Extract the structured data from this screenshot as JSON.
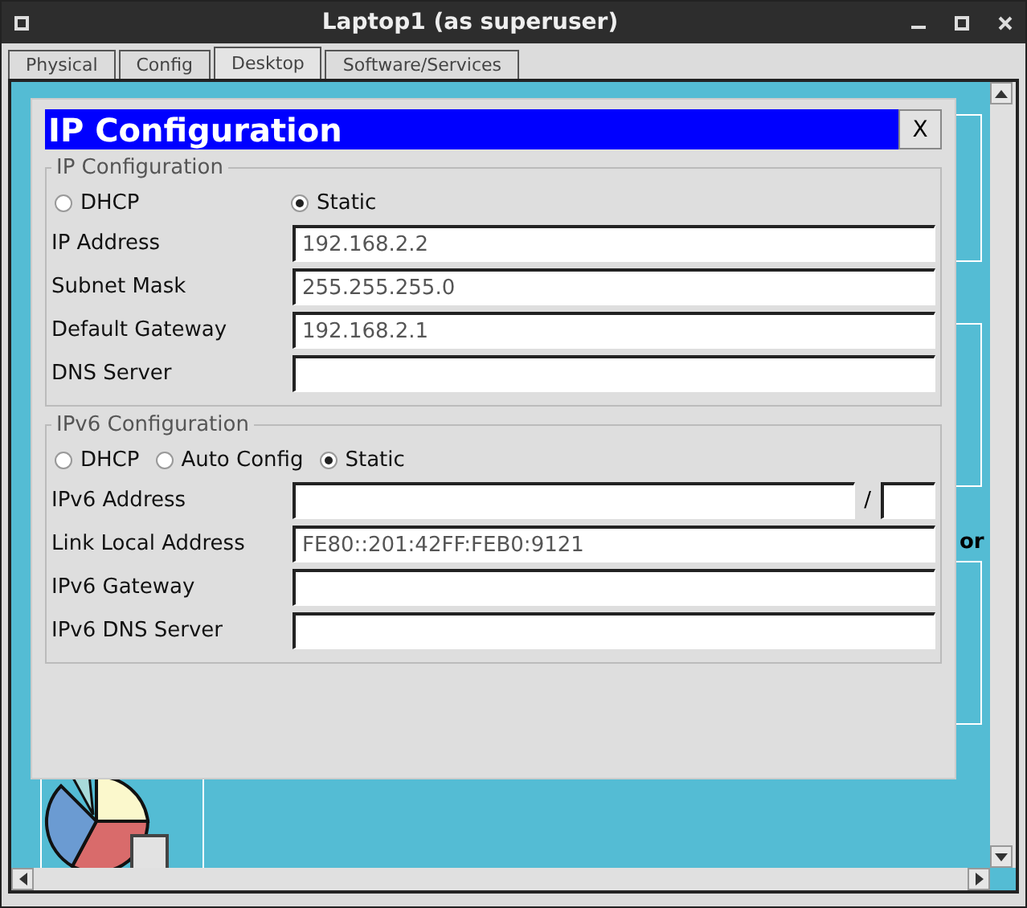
{
  "window": {
    "title": "Laptop1 (as superuser)"
  },
  "tabs": [
    {
      "label": "Physical",
      "selected": false
    },
    {
      "label": "Config",
      "selected": false
    },
    {
      "label": "Desktop",
      "selected": true
    },
    {
      "label": "Software/Services",
      "selected": false
    }
  ],
  "desktop": {
    "partial_label": "or"
  },
  "dialog": {
    "title": "IP Configuration",
    "close": "X",
    "sections": [
      {
        "legend": "IP Configuration",
        "modes": [
          {
            "label": "DHCP",
            "selected": false
          },
          {
            "label": "Static",
            "selected": true
          }
        ],
        "fields": [
          {
            "label": "IP Address",
            "value": "192.168.2.2"
          },
          {
            "label": "Subnet Mask",
            "value": "255.255.255.0"
          },
          {
            "label": "Default Gateway",
            "value": "192.168.2.1"
          },
          {
            "label": "DNS Server"
          }
        ]
      },
      {
        "legend": "IPv6 Configuration",
        "modes": [
          {
            "label": "DHCP",
            "selected": false
          },
          {
            "label": "Auto Config",
            "selected": false
          },
          {
            "label": "Static",
            "selected": true
          }
        ],
        "fields": [
          {
            "label": "IPv6 Address",
            "kind": "prefixed",
            "separator": "/"
          },
          {
            "label": "Link Local Address",
            "value": "FE80::201:42FF:FEB0:9121"
          },
          {
            "label": "IPv6 Gateway"
          },
          {
            "label": "IPv6 DNS Server"
          }
        ]
      }
    ]
  }
}
